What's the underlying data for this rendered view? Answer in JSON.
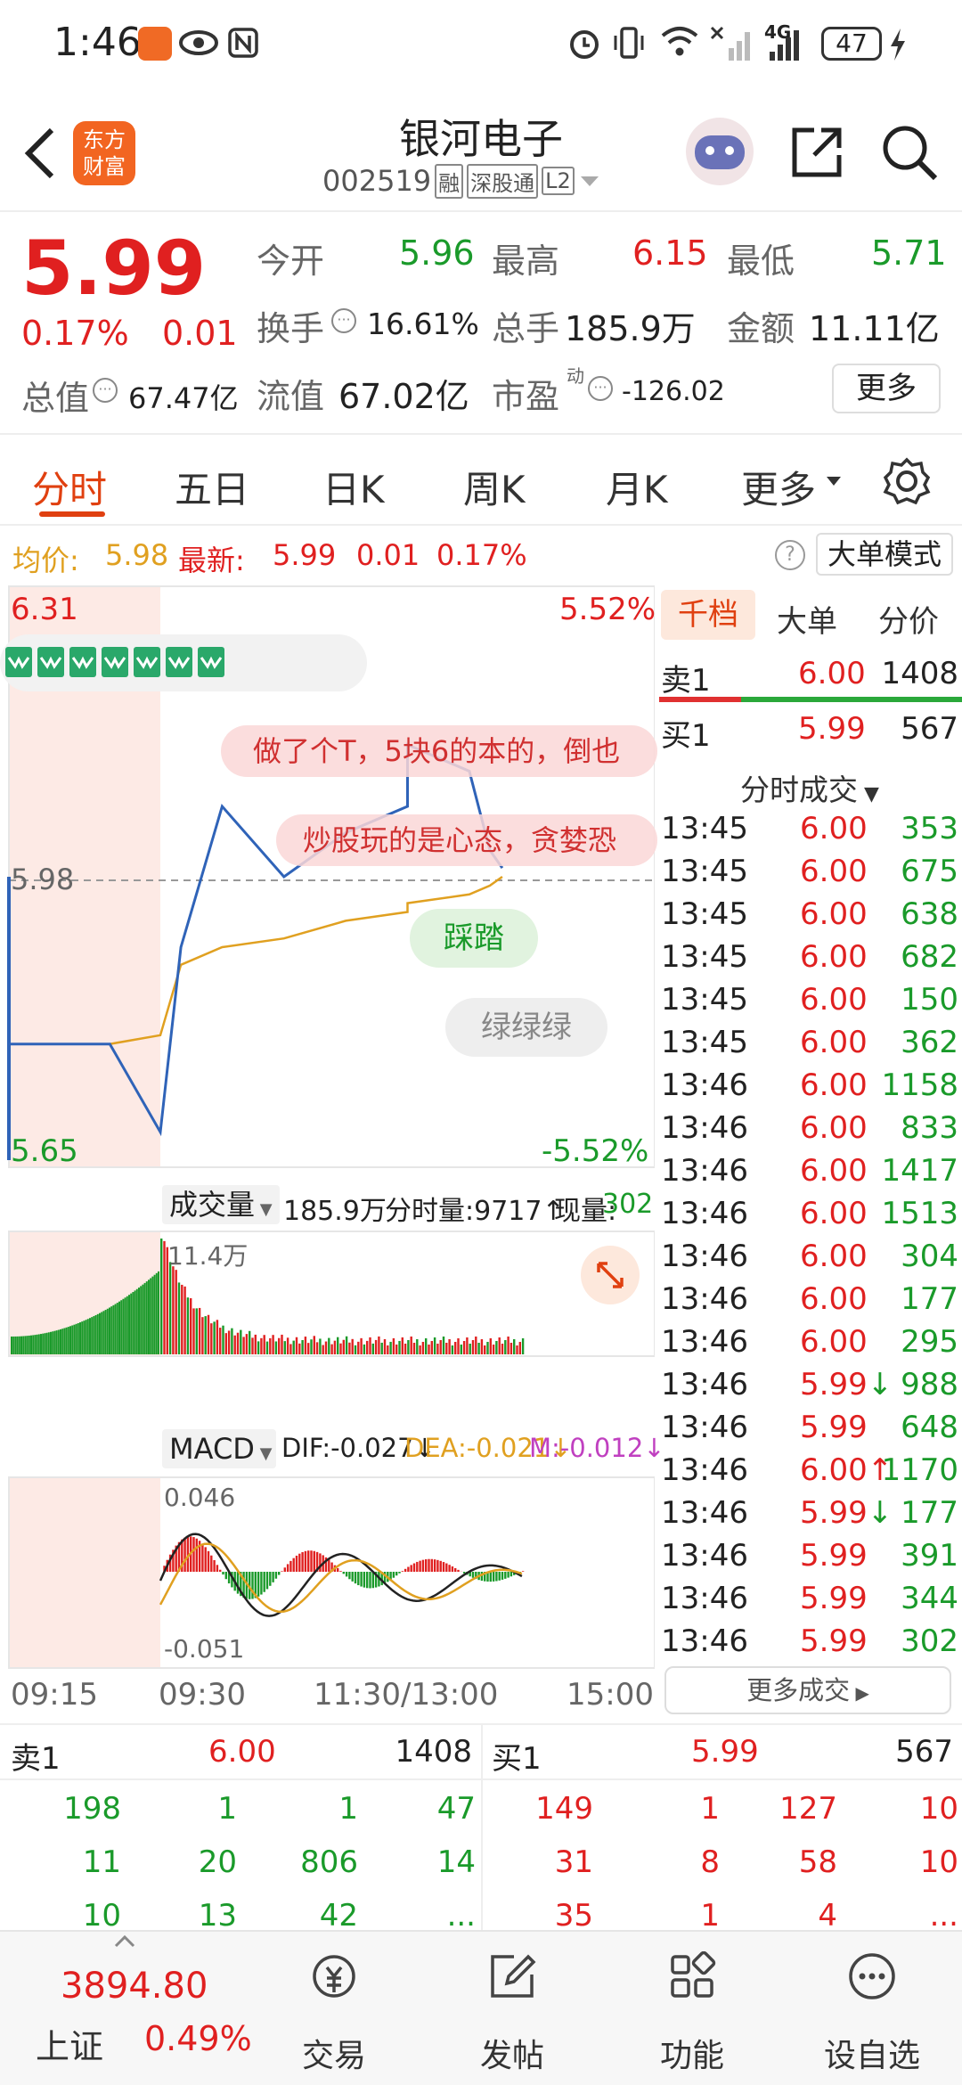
{
  "status_bar": {
    "time": "1:46",
    "network": "4G",
    "battery": "47"
  },
  "header": {
    "logo_line1": "东方",
    "logo_line2": "财富",
    "stock_name": "银河电子",
    "stock_code": "002519",
    "tags": [
      "融",
      "深股通",
      "L2"
    ]
  },
  "quote": {
    "price": "5.99",
    "change_pct": "0.17%",
    "change": "0.01",
    "open_label": "今开",
    "open": "5.96",
    "high_label": "最高",
    "high": "6.15",
    "low_label": "最低",
    "low": "5.71",
    "turnover_label": "换手",
    "turnover": "16.61%",
    "volume_label": "总手",
    "volume": "185.9万",
    "amount_label": "金额",
    "amount": "11.11亿",
    "mktcap_label": "总值",
    "mktcap": "67.47亿",
    "float_label": "流值",
    "float": "67.02亿",
    "pe_label": "市盈",
    "pe_sup": "动",
    "pe": "-126.02",
    "more_button": "更多"
  },
  "tabs": [
    "分时",
    "五日",
    "日K",
    "周K",
    "月K",
    "更多"
  ],
  "info_bar": {
    "avg_label": "均价:",
    "avg": "5.98",
    "latest_label": "最新:",
    "latest": "5.99",
    "chg": "0.01",
    "pct": "0.17%",
    "mode_button": "大单模式"
  },
  "chart": {
    "y_top": "6.31",
    "y_top_pct": "5.52%",
    "y_mid": "5.98",
    "y_bottom": "5.65",
    "y_bottom_pct": "-5.52%",
    "bubble1": "做了个T，5块6的本的，倒也",
    "bubble2": "炒股玩的是心态，贪婪恐",
    "pill1": "踩踏",
    "pill2": "绿绿绿",
    "vol_label": "成交量",
    "vol_total": "185.9万",
    "vol_minute": "分时量:9717↑",
    "vol_now_label": "现量:",
    "vol_now": "302",
    "vol_max": "11.4万",
    "macd_label": "MACD",
    "dif": "DIF:-0.027↓",
    "dea": "DEA:-0.021↓",
    "m": "M:-0.012↓",
    "macd_top": "0.046",
    "macd_bottom": "-0.051",
    "times": [
      "09:15",
      "09:30",
      "11:30/13:00",
      "15:00"
    ],
    "series": {
      "x": [
        "09:15",
        "09:25",
        "09:30",
        "09:40",
        "10:00",
        "10:30",
        "11:00",
        "11:30",
        "13:00",
        "13:30",
        "13:40",
        "13:46"
      ],
      "price": [
        5.79,
        5.79,
        5.69,
        5.9,
        6.06,
        5.98,
        6.03,
        6.06,
        6.13,
        6.1,
        6.01,
        5.99
      ],
      "avg": [
        5.79,
        5.79,
        5.8,
        5.88,
        5.9,
        5.91,
        5.93,
        5.94,
        5.95,
        5.96,
        5.97,
        5.98
      ]
    }
  },
  "right_panel": {
    "tabs": [
      "千档",
      "大单",
      "分价"
    ],
    "sell1_label": "卖1",
    "sell1_price": "6.00",
    "sell1_vol": "1408",
    "buy1_label": "买1",
    "buy1_price": "5.99",
    "buy1_vol": "567",
    "ticks_title": "分时成交",
    "ticks": [
      {
        "t": "13:45",
        "p": "6.00",
        "v": "353"
      },
      {
        "t": "13:45",
        "p": "6.00",
        "v": "675"
      },
      {
        "t": "13:45",
        "p": "6.00",
        "v": "638"
      },
      {
        "t": "13:45",
        "p": "6.00",
        "v": "682"
      },
      {
        "t": "13:45",
        "p": "6.00",
        "v": "150"
      },
      {
        "t": "13:45",
        "p": "6.00",
        "v": "362"
      },
      {
        "t": "13:46",
        "p": "6.00",
        "v": "1158"
      },
      {
        "t": "13:46",
        "p": "6.00",
        "v": "833"
      },
      {
        "t": "13:46",
        "p": "6.00",
        "v": "1417"
      },
      {
        "t": "13:46",
        "p": "6.00",
        "v": "1513"
      },
      {
        "t": "13:46",
        "p": "6.00",
        "v": "304"
      },
      {
        "t": "13:46",
        "p": "6.00",
        "v": "177"
      },
      {
        "t": "13:46",
        "p": "6.00",
        "v": "295"
      },
      {
        "t": "13:46",
        "p": "5.99↓",
        "v": "988"
      },
      {
        "t": "13:46",
        "p": "5.99",
        "v": "648"
      },
      {
        "t": "13:46",
        "p": "6.00↑",
        "v": "1170"
      },
      {
        "t": "13:46",
        "p": "5.99↓",
        "v": "177"
      },
      {
        "t": "13:46",
        "p": "5.99",
        "v": "391"
      },
      {
        "t": "13:46",
        "p": "5.99",
        "v": "344"
      },
      {
        "t": "13:46",
        "p": "5.99",
        "v": "302"
      }
    ],
    "more_ticks": "更多成交"
  },
  "order_book": {
    "sell_label": "卖1",
    "sell_price": "6.00",
    "sell_total": "1408",
    "buy_label": "买1",
    "buy_price": "5.99",
    "buy_total": "567",
    "sell_rows": [
      [
        "198",
        "1",
        "1",
        "47"
      ],
      [
        "11",
        "20",
        "806",
        "14"
      ],
      [
        "10",
        "13",
        "42",
        "..."
      ]
    ],
    "buy_rows": [
      [
        "149",
        "1",
        "127",
        "10"
      ],
      [
        "31",
        "8",
        "58",
        "10"
      ],
      [
        "35",
        "1",
        "4",
        "..."
      ]
    ]
  },
  "bottom_nav": {
    "index_value": "3894.80",
    "index_name": "上证",
    "index_pct": "0.49%",
    "items": [
      "交易",
      "发帖",
      "功能",
      "设自选"
    ]
  },
  "colors": {
    "up": "#e02020",
    "down": "#1a9a2a",
    "accent": "#e04010",
    "price_line": "#2f63b8",
    "avg_line": "#e0a020"
  }
}
